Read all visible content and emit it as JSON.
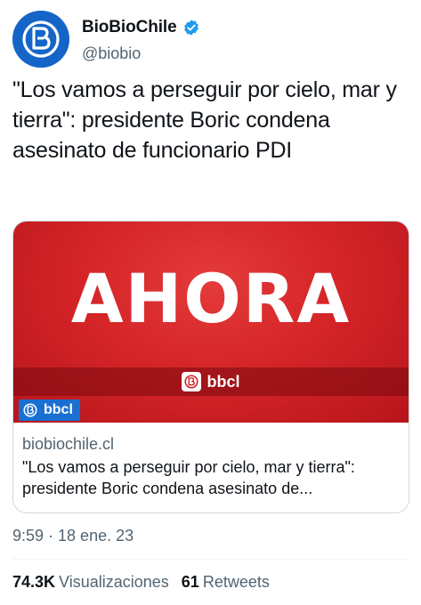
{
  "author": {
    "display_name": "BioBioChile",
    "handle": "@biobio",
    "verified": true,
    "avatar_icon": "biobio-logo-icon",
    "brand_color": "#1565c8"
  },
  "tweet": {
    "text": "\"Los vamos a perseguir por cielo, mar y tierra\": presidente Boric condena asesinato de funcionario PDI"
  },
  "card": {
    "image": {
      "headline": "AHORA",
      "band_label": "bbcl",
      "corner_label": "bbcl",
      "background_color": "#d52528"
    },
    "domain": "biobiochile.cl",
    "title": "\"Los vamos a perseguir por cielo, mar y tierra\": presidente Boric condena asesinato de..."
  },
  "meta": {
    "timestamp": "9:59 · 18 ene. 23"
  },
  "stats": {
    "views_value": "74.3K",
    "views_label": "Visualizaciones",
    "retweets_value": "61",
    "retweets_label": "Retweets"
  }
}
